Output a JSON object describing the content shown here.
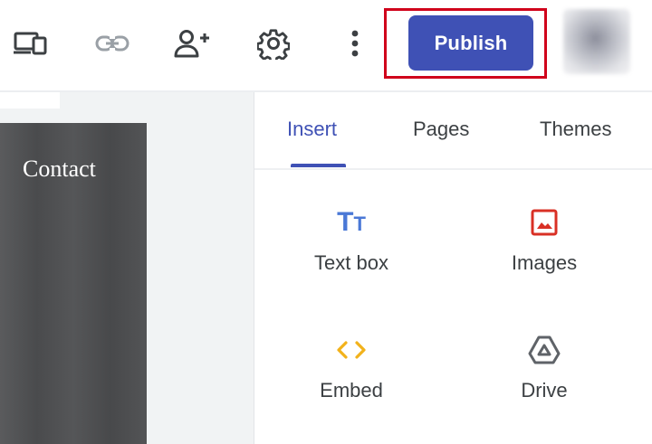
{
  "toolbar": {
    "icons": [
      {
        "name": "devices-preview-icon",
        "label": ""
      },
      {
        "name": "link-icon",
        "label": ""
      },
      {
        "name": "share-add-person-icon",
        "label": ""
      },
      {
        "name": "settings-gear-icon",
        "label": ""
      },
      {
        "name": "more-vert-icon",
        "label": ""
      }
    ],
    "publish_label": "Publish"
  },
  "canvas": {
    "contact_text": "Contact"
  },
  "panel": {
    "tabs": [
      {
        "label": "Insert",
        "active": true
      },
      {
        "label": "Pages",
        "active": false
      },
      {
        "label": "Themes",
        "active": false
      }
    ],
    "tiles": [
      {
        "label": "Text box",
        "icon": "text-box-icon"
      },
      {
        "label": "Images",
        "icon": "image-icon"
      },
      {
        "label": "Embed",
        "icon": "embed-code-icon"
      },
      {
        "label": "Drive",
        "icon": "drive-icon"
      }
    ]
  },
  "colors": {
    "accent": "#3f51b5",
    "highlight": "#d0021b",
    "text_box_icon": "#4a78d6",
    "image_icon": "#d93025",
    "embed_icon": "#f2b21b",
    "icon_gray": "#5f6368"
  }
}
